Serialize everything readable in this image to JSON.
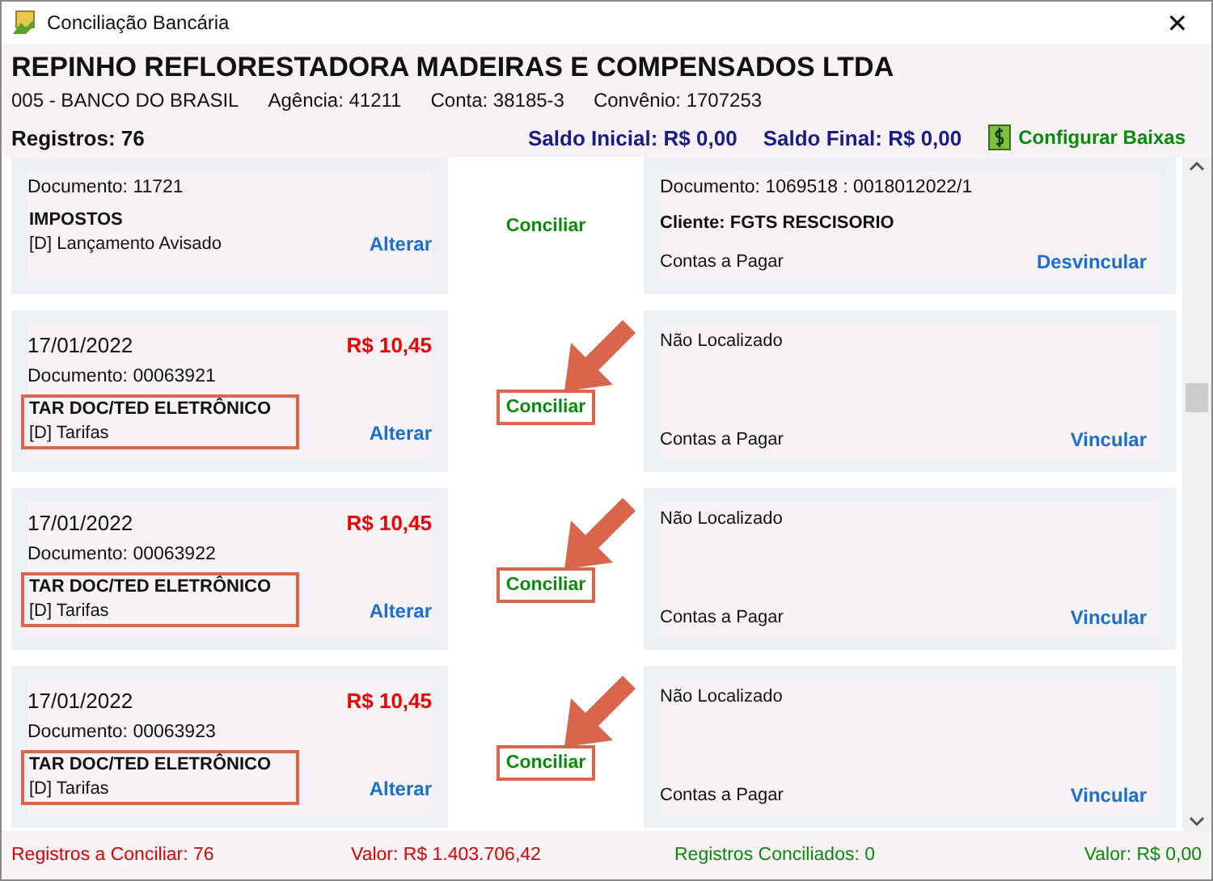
{
  "window": {
    "title": "Conciliação Bancária",
    "close": "✕"
  },
  "header": {
    "company": "REPINHO REFLORESTADORA MADEIRAS E COMPENSADOS LTDA",
    "bank": "005 - BANCO DO BRASIL",
    "agency": "Agência: 41211",
    "account": "Conta: 38185-3",
    "agreement": "Convênio: 1707253",
    "records": "Registros: 76",
    "opening_balance": "Saldo Inicial: R$ 0,00",
    "closing_balance": "Saldo Final: R$ 0,00",
    "configure": "Configurar Baixas"
  },
  "rows": [
    {
      "document": "Documento: 11721",
      "description": "IMPOSTOS",
      "category": "[D] Lançamento Avisado",
      "edit": "Alterar",
      "reconcile": "Conciliar",
      "highlighted": false,
      "match": {
        "document": "Documento: 1069518 : 0018012022/1",
        "client": "Cliente: FGTS RESCISORIO",
        "type": "Contas a Pagar",
        "action": "Desvincular"
      }
    },
    {
      "date": "17/01/2022",
      "amount": "R$ 10,45",
      "document": "Documento: 00063921",
      "description": "TAR DOC/TED ELETRÔNICO",
      "category": "[D] Tarifas",
      "edit": "Alterar",
      "reconcile": "Conciliar",
      "highlighted": true,
      "match": {
        "status": "Não Localizado",
        "type": "Contas a Pagar",
        "action": "Vincular"
      }
    },
    {
      "date": "17/01/2022",
      "amount": "R$ 10,45",
      "document": "Documento: 00063922",
      "description": "TAR DOC/TED ELETRÔNICO",
      "category": "[D] Tarifas",
      "edit": "Alterar",
      "reconcile": "Conciliar",
      "highlighted": true,
      "match": {
        "status": "Não Localizado",
        "type": "Contas a Pagar",
        "action": "Vincular"
      }
    },
    {
      "date": "17/01/2022",
      "amount": "R$ 10,45",
      "document": "Documento: 00063923",
      "description": "TAR DOC/TED ELETRÔNICO",
      "category": "[D] Tarifas",
      "edit": "Alterar",
      "reconcile": "Conciliar",
      "highlighted": true,
      "match": {
        "status": "Não Localizado",
        "type": "Contas a Pagar",
        "action": "Vincular"
      }
    }
  ],
  "footer": {
    "pending": "Registros a Conciliar: 76",
    "pending_value": "Valor: R$ 1.403.706,42",
    "reconciled": "Registros Conciliados: 0",
    "reconciled_value": "Valor: R$ 0,00"
  }
}
